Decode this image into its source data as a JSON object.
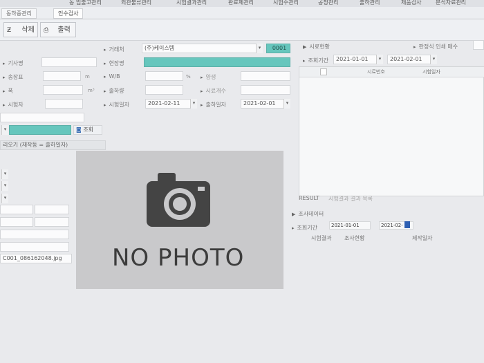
{
  "menubar": {
    "items": [
      "동 입출고관리",
      "외관불류관리",
      "시험결과관리",
      "완료제관리",
      "시험주관리",
      "공정관리",
      "출하관리",
      "제품검사",
      "분석자료관리"
    ]
  },
  "tabs": [
    {
      "label": "동하중관리"
    },
    {
      "label": "인수검사"
    }
  ],
  "toolbar": {
    "delete_label": "삭제",
    "print_label": "출력"
  },
  "form": {
    "company_label": "거래처",
    "company_value": "(주)케이스템",
    "company_code": "0001",
    "site_label": "현장명",
    "article_label": "기사명",
    "ticket_label": "송장표",
    "wb_label": "W/B",
    "width_label": "폭",
    "outbound_label": "출하량",
    "tester_label": "시험자",
    "test_date_label": "시험일자",
    "test_date_value": "2021-02-11",
    "receive_date_label": "출하일자",
    "receive_date_value": "2021-02-01",
    "unit_m": "m",
    "unit_pct": "%",
    "unit_m3": "m³",
    "search_button": "조회",
    "memo_hint": "리오기 (재작동 = 출하일자)",
    "file_name": "C001_086162048.jpg"
  },
  "photo": {
    "caption": "NO PHOTO",
    "icon": "camera-icon"
  },
  "right_panel": {
    "section_title": "시료현황",
    "option_label": "판정식 인쇄 매수",
    "period_label": "조회기간",
    "date_from": "2021-01-01",
    "date_to": "2021-02-01",
    "col_sample": "시료번호",
    "col_date": "시험일자",
    "result_label": "RESULT",
    "result_hint": "시험결과 결과 목록",
    "bottom_title": "조사데이터",
    "bottom_period_label": "조회기간",
    "bottom_from": "2021-01-01",
    "bottom_to": "2021-02-",
    "bottom_col_1": "시험결과",
    "bottom_col_2": "조사현황",
    "bottom_col_3": "제작일자"
  }
}
